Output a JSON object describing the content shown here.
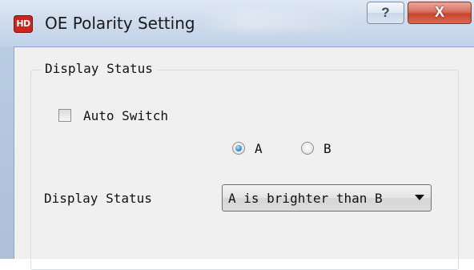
{
  "window": {
    "title": "OE Polarity Setting",
    "logo_text": "HD",
    "help_label": "?",
    "close_label": "X"
  },
  "group": {
    "label": "Display Status",
    "auto_switch": {
      "label": "Auto Switch",
      "checked": false
    },
    "radios": [
      {
        "label": "A",
        "selected": true
      },
      {
        "label": "B",
        "selected": false
      }
    ],
    "display_status": {
      "label": "Display Status",
      "selected_value": "A is brighter than B"
    }
  },
  "colors": {
    "accent_radio": "#3f8fd3",
    "close_button": "#c6452f",
    "logo": "#c8261f"
  }
}
